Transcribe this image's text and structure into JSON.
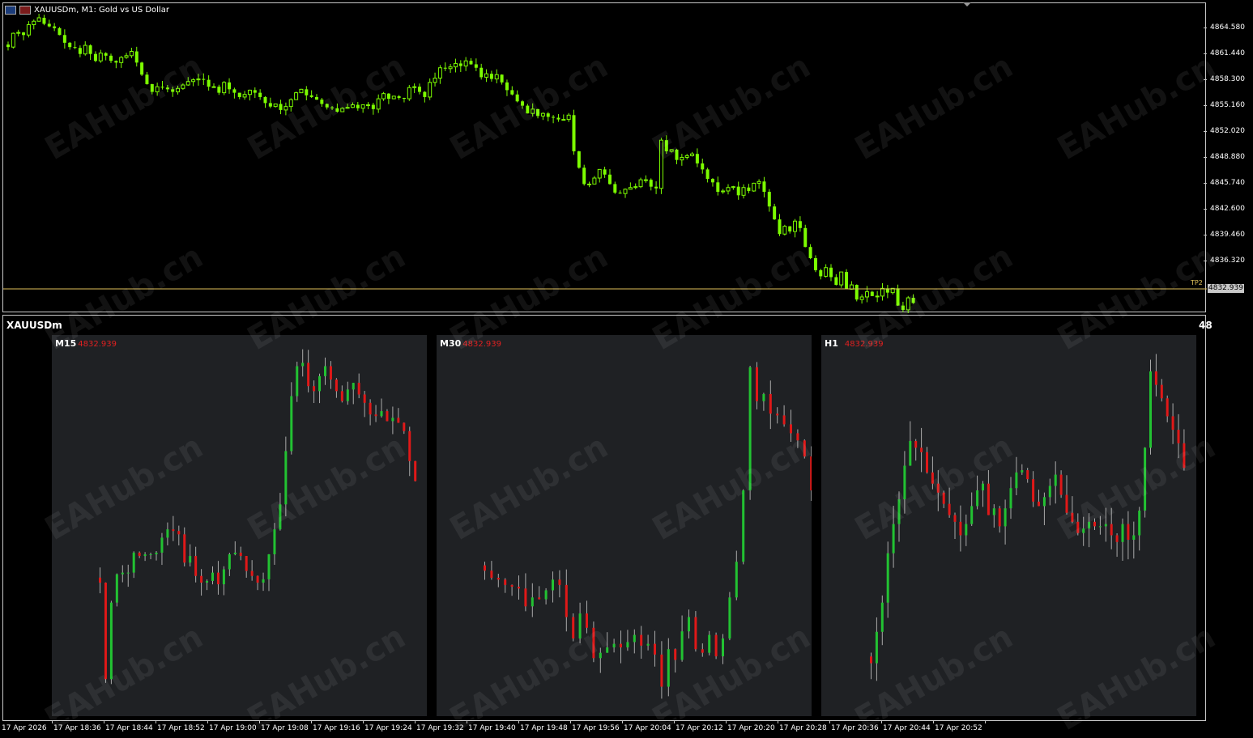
{
  "window": {
    "symbol_title": "XAUUSDm, M1:  Gold vs US Dollar",
    "current_price": "4832.939",
    "tp_label": "TP2"
  },
  "price_axis": [
    "4864.580",
    "4861.440",
    "4858.300",
    "4855.160",
    "4852.020",
    "4848.880",
    "4845.740",
    "4842.600",
    "4839.460",
    "4836.320"
  ],
  "subpanel": {
    "title": "XAUUSDm",
    "right_text": "48",
    "panels": [
      {
        "label": "M15",
        "price": "4832.939"
      },
      {
        "label": "M30",
        "price": "4832.939"
      },
      {
        "label": "H1",
        "price": "4832.939"
      }
    ]
  },
  "time_axis": [
    "17 Apr 2026",
    "17 Apr 18:36",
    "17 Apr 18:44",
    "17 Apr 18:52",
    "17 Apr 19:00",
    "17 Apr 19:08",
    "17 Apr 19:16",
    "17 Apr 19:24",
    "17 Apr 19:32",
    "17 Apr 19:40",
    "17 Apr 19:48",
    "17 Apr 19:56",
    "17 Apr 20:04",
    "17 Apr 20:12",
    "17 Apr 20:20",
    "17 Apr 20:28",
    "17 Apr 20:36",
    "17 Apr 20:44",
    "17 Apr 20:52"
  ],
  "watermark": "EAHub.cn",
  "colors": {
    "bull_main": "#7cfc00",
    "bull": "#22c232",
    "bear": "#e01818",
    "tp_line": "#e0c05a",
    "panel_bg": "#1f2124"
  },
  "chart_data": [
    {
      "type": "candlestick",
      "title": "XAUUSDm, M1:  Gold vs US Dollar",
      "ylim": [
        4832.0,
        4867.5
      ],
      "series": [
        {
          "closes": [
            4862.6,
            4864.2,
            4864.3,
            4864.0,
            4865.2,
            4865.6,
            4866.0,
            4865.3,
            4865.0,
            4864.8,
            4864.0,
            4863.1,
            4862.6,
            4862.5,
            4861.8,
            4862.8,
            4861.8,
            4861.0,
            4861.9,
            4861.6,
            4861.0,
            4860.8,
            4861.4,
            4861.6,
            4862.1,
            4860.8,
            4859.4,
            4858.3,
            4857.4,
            4858.0,
            4857.9,
            4857.7,
            4857.4,
            4857.8,
            4858.2,
            4858.6,
            4858.8,
            4858.9,
            4858.8,
            4858.0,
            4858.0,
            4857.3,
            4858.5,
            4857.7,
            4857.3,
            4856.8,
            4857.1,
            4857.6,
            4857.3,
            4856.8,
            4856.1,
            4855.7,
            4856.0,
            4855.3,
            4855.7,
            4856.5,
            4857.3,
            4857.7,
            4857.0,
            4856.8,
            4856.5,
            4856.0,
            4855.6,
            4855.5,
            4855.1,
            4855.5,
            4855.6,
            4855.9,
            4855.5,
            4855.9,
            4855.9,
            4855.4,
            4856.6,
            4857.2,
            4856.6,
            4856.9,
            4856.7,
            4856.6,
            4857.9,
            4858.0,
            4857.4,
            4856.8,
            4858.5,
            4859.0,
            4860.2,
            4860.1,
            4860.3,
            4860.7,
            4860.4,
            4861.0,
            4860.6,
            4860.2,
            4859.1,
            4859.5,
            4858.9,
            4859.4,
            4858.5,
            4857.6,
            4857.1,
            4856.3,
            4855.8,
            4854.9,
            4855.4,
            4854.6,
            4854.9,
            4854.5,
            4854.4,
            4854.2,
            4854.2,
            4854.7,
            4850.5,
            4848.6,
            4846.7,
            4846.7,
            4847.4,
            4848.4,
            4847.8,
            4846.7,
            4845.7,
            4845.6,
            4846.1,
            4846.3,
            4846.4,
            4847.2,
            4847.2,
            4846.4,
            4846.2,
            4851.8,
            4850.5,
            4850.7,
            4849.5,
            4849.8,
            4850.0,
            4850.2,
            4849.1,
            4848.4,
            4847.3,
            4846.9,
            4845.8,
            4845.9,
            4846.3,
            4846.4,
            4845.4,
            4846.3,
            4845.9,
            4846.8,
            4847.0,
            4845.8,
            4844.1,
            4842.6,
            4840.9,
            4841.8,
            4841.2,
            4842.4,
            4841.6,
            4839.4,
            4838.1,
            4836.7,
            4836.0,
            4837.0,
            4835.9,
            4835.0,
            4836.5,
            4834.5,
            4835.0,
            4833.3,
            4833.6,
            4834.2,
            4833.7,
            4833.7,
            4834.6,
            4834.1,
            4834.6,
            4832.6,
            4832.1,
            4833.5,
            4832.9
          ]
        }
      ]
    },
    {
      "type": "candlestick",
      "title": "M15",
      "series": [
        {
          "closes": [
            4836.0,
            4830.2,
            4834.8,
            4836.5,
            4836.6,
            4836.6,
            4837.8,
            4837.6,
            4837.7,
            4837.7,
            4837.8,
            4838.7,
            4839.2,
            4839.1,
            4838.9,
            4837.2,
            4837.6,
            4836.4,
            4836.0,
            4836.1,
            4836.6,
            4835.9,
            4836.8,
            4837.7,
            4837.8,
            4837.6,
            4836.7,
            4836.4,
            4836.0,
            4836.2,
            4837.7,
            4839.2,
            4840.7,
            4843.9,
            4847.2,
            4849.0,
            4849.2,
            4847.8,
            4847.5,
            4848.4,
            4849.0,
            4848.2,
            4847.5,
            4846.9,
            4847.6,
            4848.0,
            4847.3,
            4846.8,
            4846.1,
            4846.0,
            4846.3,
            4845.7,
            4845.9,
            4845.6,
            4845.1,
            4843.3,
            4842.1
          ]
        }
      ],
      "ylim": [
        4829.0,
        4849.9
      ]
    },
    {
      "type": "candlestick",
      "title": "M30",
      "series": [
        {
          "closes": [
            4835.2,
            4834.8,
            4834.7,
            4834.4,
            4834.3,
            4834.2,
            4833.2,
            4833.7,
            4833.6,
            4834.1,
            4834.7,
            4834.4,
            4832.6,
            4831.4,
            4832.8,
            4832.0,
            4830.3,
            4830.6,
            4830.9,
            4831.1,
            4830.9,
            4831.2,
            4831.6,
            4831.0,
            4831.1,
            4830.5,
            4828.7,
            4830.8,
            4830.2,
            4831.8,
            4832.6,
            4830.8,
            4830.6,
            4831.6,
            4830.4,
            4831.4,
            4833.7,
            4835.7,
            4839.7,
            4846.6,
            4844.7,
            4845.1,
            4844.0,
            4843.9,
            4843.4,
            4842.9,
            4842.5,
            4841.6,
            4839.7
          ]
        }
      ],
      "ylim": [
        4828.0,
        4847.5
      ]
    },
    {
      "type": "candlestick",
      "title": "H1",
      "series": [
        {
          "closes": [
            4836.6,
            4838.0,
            4839.3,
            4841.5,
            4842.8,
            4843.9,
            4845.4,
            4846.5,
            4846.2,
            4846.0,
            4845.1,
            4844.6,
            4844.2,
            4843.7,
            4843.2,
            4842.9,
            4842.3,
            4842.8,
            4843.6,
            4844.3,
            4844.6,
            4843.2,
            4843.5,
            4842.7,
            4843.5,
            4844.4,
            4845.1,
            4845.2,
            4844.8,
            4843.8,
            4843.6,
            4844.0,
            4844.5,
            4845.0,
            4844.1,
            4843.3,
            4842.9,
            4842.4,
            4842.6,
            4842.9,
            4842.7,
            4842.7,
            4842.8,
            4842.3,
            4842.0,
            4842.8,
            4842.1,
            4842.3,
            4843.4,
            4846.2,
            4849.6,
            4849.0,
            4848.4,
            4847.6,
            4847.0,
            4846.4,
            4845.3
          ]
        }
      ],
      "ylim": [
        4835.0,
        4850.5
      ]
    }
  ]
}
